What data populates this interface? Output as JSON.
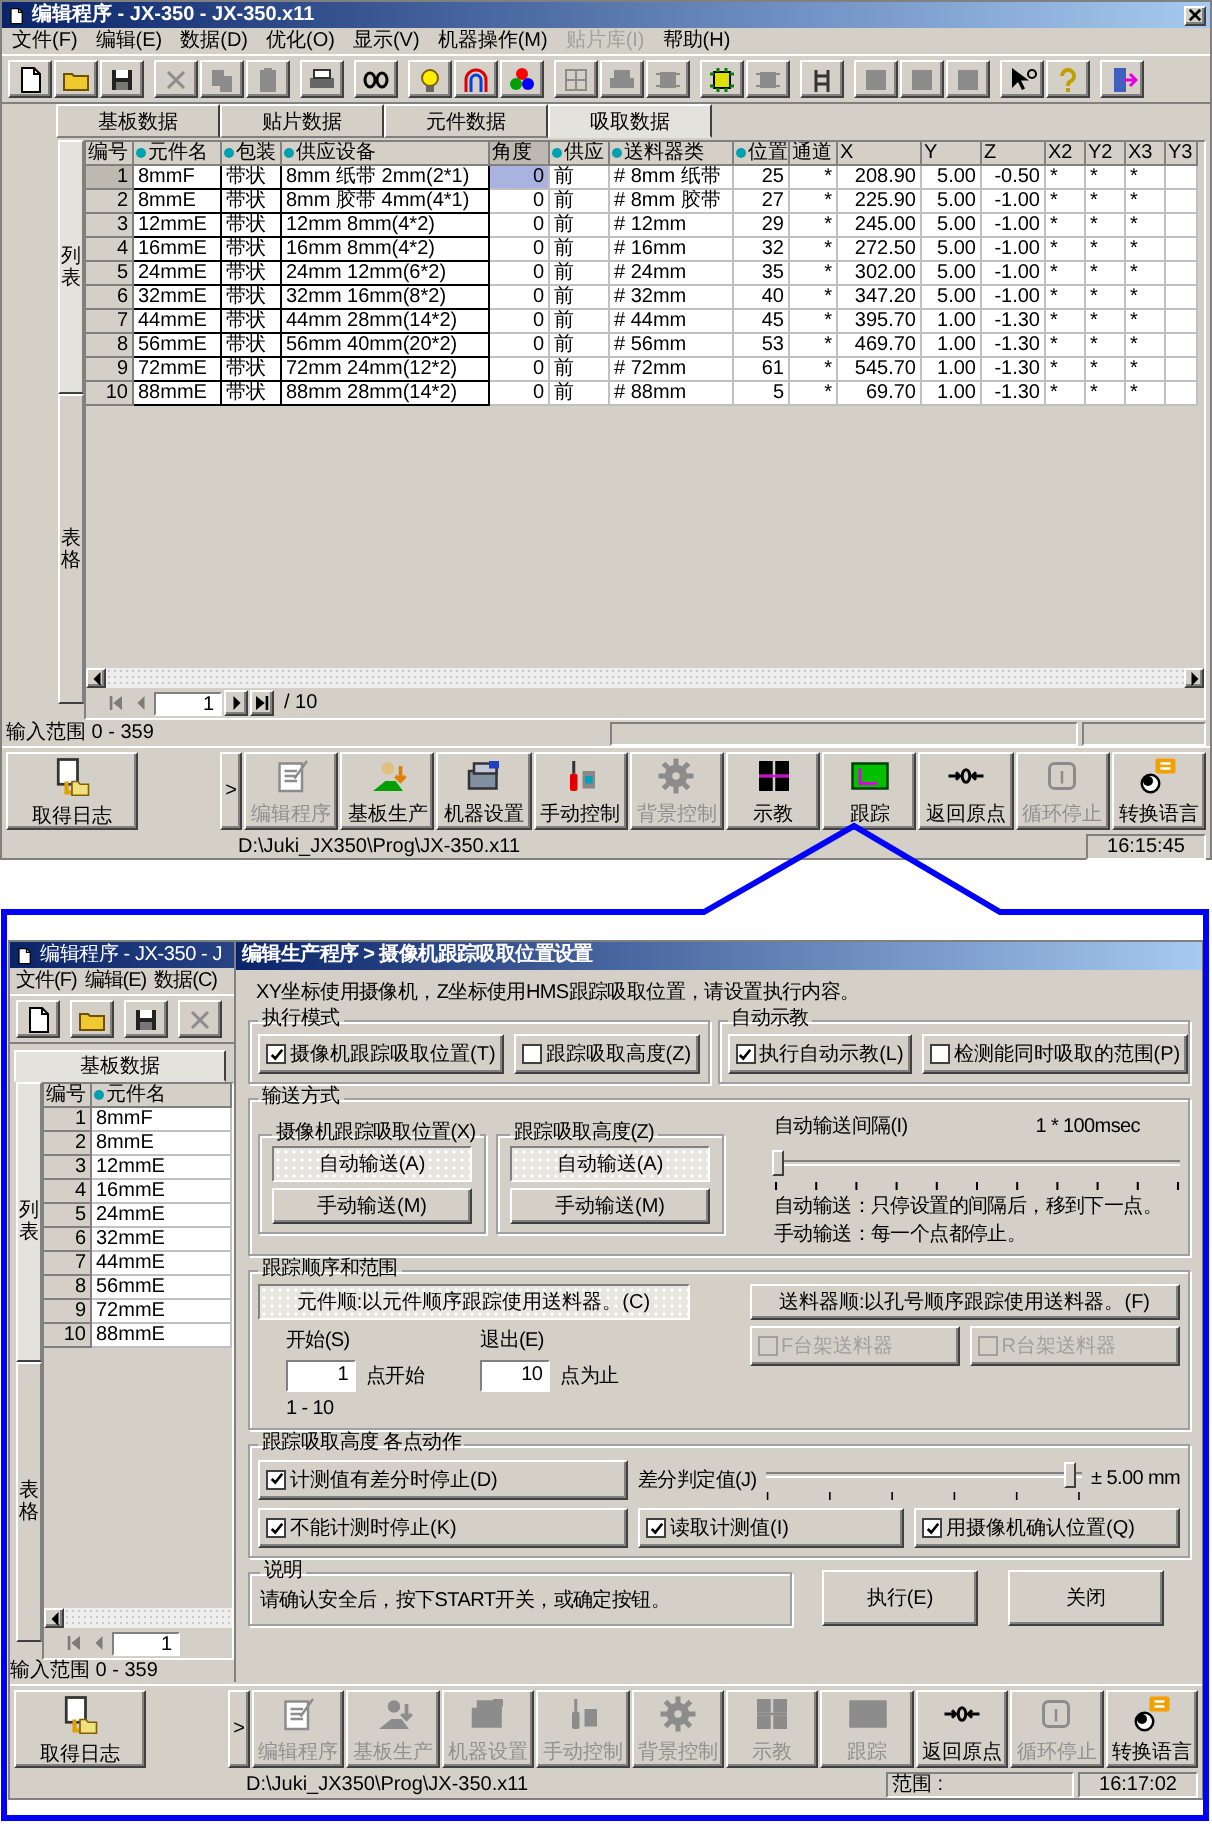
{
  "main_window": {
    "title": "编辑程序 - JX-350 - JX-350.x11",
    "menu": [
      {
        "label": "文件(F)",
        "disabled": false
      },
      {
        "label": "编辑(E)",
        "disabled": false
      },
      {
        "label": "数据(D)",
        "disabled": false
      },
      {
        "label": "优化(O)",
        "disabled": false
      },
      {
        "label": "显示(V)",
        "disabled": false
      },
      {
        "label": "机器操作(M)",
        "disabled": false
      },
      {
        "label": "贴片库(I)",
        "disabled": true
      },
      {
        "label": "帮助(H)",
        "disabled": false
      }
    ],
    "toolbar_groups": [
      [
        {
          "disabled": false
        },
        {
          "disabled": false
        },
        {
          "disabled": false
        }
      ],
      [
        {
          "disabled": true
        },
        {
          "disabled": true
        },
        {
          "disabled": true
        }
      ],
      [
        {
          "disabled": false
        }
      ],
      [
        {
          "disabled": false
        }
      ],
      [
        {
          "disabled": false
        },
        {
          "disabled": false
        },
        {
          "disabled": false
        }
      ],
      [
        {
          "disabled": true
        },
        {
          "disabled": true
        },
        {
          "disabled": true
        }
      ],
      [
        {
          "disabled": false
        },
        {
          "disabled": true
        }
      ],
      [
        {
          "disabled": false
        }
      ],
      [
        {
          "disabled": true
        },
        {
          "disabled": true
        },
        {
          "disabled": true
        }
      ],
      [
        {
          "disabled": false
        },
        {
          "disabled": false
        }
      ],
      [
        {
          "disabled": false
        }
      ]
    ],
    "tabs": [
      {
        "label": "基板数据",
        "selected": false
      },
      {
        "label": "贴片数据",
        "selected": false
      },
      {
        "label": "元件数据",
        "selected": false
      },
      {
        "label": "吸取数据",
        "selected": true
      }
    ],
    "side_tabs": [
      {
        "label": "列表",
        "selected": true
      },
      {
        "label": "表格",
        "selected": false
      }
    ],
    "table": {
      "columns": [
        {
          "label": "编号",
          "marked": false,
          "selected": false
        },
        {
          "label": "元件名",
          "marked": true,
          "selected": false
        },
        {
          "label": "包装",
          "marked": true,
          "selected": false
        },
        {
          "label": "供应设备",
          "marked": true,
          "selected": false
        },
        {
          "label": "角度",
          "marked": false,
          "selected": true
        },
        {
          "label": "供应",
          "marked": true,
          "selected": false
        },
        {
          "label": "送料器类",
          "marked": true,
          "selected": false
        },
        {
          "label": "位置",
          "marked": true,
          "selected": false
        },
        {
          "label": "通道",
          "marked": false,
          "selected": false
        },
        {
          "label": "X",
          "marked": false,
          "selected": false
        },
        {
          "label": "Y",
          "marked": false,
          "selected": false
        },
        {
          "label": "Z",
          "marked": false,
          "selected": false
        },
        {
          "label": "X2",
          "marked": false,
          "selected": false
        },
        {
          "label": "Y2",
          "marked": false,
          "selected": false
        },
        {
          "label": "X3",
          "marked": false,
          "selected": false
        },
        {
          "label": "Y3",
          "marked": false,
          "selected": false
        }
      ],
      "rows": [
        {
          "selected": true,
          "cells": [
            "1",
            "8mmF",
            "带状",
            "8mm 纸带 2mm(2*1)",
            "0",
            "前",
            "# 8mm 纸带",
            "25",
            "*",
            "208.90",
            "5.00",
            "-0.50",
            "*",
            "*",
            "*"
          ]
        },
        {
          "selected": false,
          "cells": [
            "2",
            "8mmE",
            "带状",
            "8mm 胶带 4mm(4*1)",
            "0",
            "前",
            "# 8mm 胶带",
            "27",
            "*",
            "225.90",
            "5.00",
            "-1.00",
            "*",
            "*",
            "*"
          ]
        },
        {
          "selected": false,
          "cells": [
            "3",
            "12mmE",
            "带状",
            "12mm 8mm(4*2)",
            "0",
            "前",
            "# 12mm",
            "29",
            "*",
            "245.00",
            "5.00",
            "-1.00",
            "*",
            "*",
            "*"
          ]
        },
        {
          "selected": false,
          "cells": [
            "4",
            "16mmE",
            "带状",
            "16mm 8mm(4*2)",
            "0",
            "前",
            "# 16mm",
            "32",
            "*",
            "272.50",
            "5.00",
            "-1.00",
            "*",
            "*",
            "*"
          ]
        },
        {
          "selected": false,
          "cells": [
            "5",
            "24mmE",
            "带状",
            "24mm 12mm(6*2)",
            "0",
            "前",
            "# 24mm",
            "35",
            "*",
            "302.00",
            "5.00",
            "-1.00",
            "*",
            "*",
            "*"
          ]
        },
        {
          "selected": false,
          "cells": [
            "6",
            "32mmE",
            "带状",
            "32mm 16mm(8*2)",
            "0",
            "前",
            "# 32mm",
            "40",
            "*",
            "347.20",
            "5.00",
            "-1.00",
            "*",
            "*",
            "*"
          ]
        },
        {
          "selected": false,
          "cells": [
            "7",
            "44mmE",
            "带状",
            "44mm 28mm(14*2)",
            "0",
            "前",
            "# 44mm",
            "45",
            "*",
            "395.70",
            "1.00",
            "-1.30",
            "*",
            "*",
            "*"
          ]
        },
        {
          "selected": false,
          "cells": [
            "8",
            "56mmE",
            "带状",
            "56mm 40mm(20*2)",
            "0",
            "前",
            "# 56mm",
            "53",
            "*",
            "469.70",
            "1.00",
            "-1.30",
            "*",
            "*",
            "*"
          ]
        },
        {
          "selected": false,
          "cells": [
            "9",
            "72mmE",
            "带状",
            "72mm 24mm(12*2)",
            "0",
            "前",
            "# 72mm",
            "61",
            "*",
            "545.70",
            "1.00",
            "-1.30",
            "*",
            "*",
            "*"
          ]
        },
        {
          "selected": false,
          "cells": [
            "10",
            "88mmE",
            "带状",
            "88mm 28mm(14*2)",
            "0",
            "前",
            "# 88mm",
            "5",
            "*",
            "69.70",
            "1.00",
            "-1.30",
            "*",
            "*",
            "*"
          ]
        }
      ]
    },
    "pager": {
      "page": "1",
      "total": "/ 10"
    },
    "input_range": "输入范围 0 - 359",
    "log_button": "取得日志",
    "more_button": ">",
    "buttons": [
      {
        "label": "编辑程序",
        "disabled": true
      },
      {
        "label": "基板生产",
        "disabled": false
      },
      {
        "label": "机器设置",
        "disabled": false
      },
      {
        "label": "手动控制",
        "disabled": false
      },
      {
        "label": "背景控制",
        "disabled": true
      },
      {
        "label": "示教",
        "disabled": false
      },
      {
        "label": "跟踪",
        "disabled": false
      },
      {
        "label": "返回原点",
        "disabled": false
      },
      {
        "label": "循环停止",
        "disabled": true
      },
      {
        "label": "转换语言",
        "disabled": false
      }
    ],
    "status": {
      "path": "D:\\Juki_JX350\\Prog\\JX-350.x11",
      "time": "16:15:45"
    }
  },
  "detail": {
    "background_window": {
      "title": "编辑程序 - JX-350 - J",
      "menu": [
        {
          "label": "文件(F)"
        },
        {
          "label": "编辑(E)"
        },
        {
          "label": "数据(C)"
        }
      ],
      "toolbar": [
        {
          "disabled": false
        },
        {
          "disabled": false
        },
        {
          "disabled": false
        },
        {
          "disabled": true
        }
      ],
      "tab": "基板数据",
      "side_tabs": [
        {
          "label": "列表",
          "selected": true
        },
        {
          "label": "表格",
          "selected": false
        }
      ],
      "columns": [
        {
          "label": "编号",
          "marked": false
        },
        {
          "label": "元件名",
          "marked": true
        }
      ],
      "rows": [
        {
          "number": "1",
          "name": "8mmF"
        },
        {
          "number": "2",
          "name": "8mmE"
        },
        {
          "number": "3",
          "name": "12mmE"
        },
        {
          "number": "4",
          "name": "16mmE"
        },
        {
          "number": "5",
          "name": "24mmE"
        },
        {
          "number": "6",
          "name": "32mmE"
        },
        {
          "number": "7",
          "name": "44mmE"
        },
        {
          "number": "8",
          "name": "56mmE"
        },
        {
          "number": "9",
          "name": "72mmE"
        },
        {
          "number": "10",
          "name": "88mmE"
        }
      ],
      "pager": {
        "page": "1"
      },
      "input_range": "输入范围 0 - 359",
      "log_button": "取得日志",
      "more_button": ">",
      "buttons": [
        {
          "label": "编辑程序",
          "disabled": true
        },
        {
          "label": "基板生产",
          "disabled": true
        },
        {
          "label": "机器设置",
          "disabled": true
        },
        {
          "label": "手动控制",
          "disabled": true
        },
        {
          "label": "背景控制",
          "disabled": true
        },
        {
          "label": "示教",
          "disabled": true
        },
        {
          "label": "跟踪",
          "disabled": true
        },
        {
          "label": "返回原点",
          "disabled": false
        },
        {
          "label": "循环停止",
          "disabled": true
        },
        {
          "label": "转换语言",
          "disabled": false
        }
      ],
      "status": {
        "path": "D:\\Juki_JX350\\Prog\\JX-350.x11",
        "range": "范围 :",
        "time": "16:17:02"
      }
    },
    "dialog": {
      "title": "编辑生产程序 > 摄像机跟踪吸取位置设置",
      "intro": "XY坐标使用摄像机，Z坐标使用HMS跟踪吸取位置，请设置执行内容。",
      "mode_group": {
        "title": "执行模式",
        "options": [
          {
            "label": "摄像机跟踪吸取位置(T)",
            "checked": true
          },
          {
            "label": "跟踪吸取高度(Z)",
            "checked": false
          }
        ]
      },
      "teach_group": {
        "title": "自动示教",
        "options": [
          {
            "label": "执行自动示教(L)",
            "checked": true
          },
          {
            "label": "检测能同时吸取的范围(P)",
            "checked": false
          }
        ]
      },
      "feed_group": {
        "title": "输送方式",
        "subgroups": [
          {
            "title": "摄像机跟踪吸取位置(X)",
            "options": [
              {
                "label": "自动输送(A)",
                "selected": true
              },
              {
                "label": "手动输送(M)",
                "selected": false
              }
            ]
          },
          {
            "title": "跟踪吸取高度(Z)",
            "options": [
              {
                "label": "自动输送(A)",
                "selected": true
              },
              {
                "label": "手动输送(M)",
                "selected": false
              }
            ]
          }
        ],
        "interval_label": "自动输送间隔(I)",
        "interval_value": "1 * 100msec",
        "interval_slider": {
          "level": 0
        },
        "notes": [
          "自动输送：只停设置的间隔后，移到下一点。",
          "手动输送：每一个点都停止。"
        ]
      },
      "order_group": {
        "title": "跟踪顺序和范围",
        "modes": [
          {
            "label": "元件顺:以元件顺序跟踪使用送料器。(C)",
            "selected": true
          },
          {
            "label": "送料器顺:以孔号顺序跟踪使用送料器。(F)",
            "selected": false
          }
        ],
        "tables": [
          {
            "label": "F台架送料器",
            "checked": false,
            "disabled": true
          },
          {
            "label": "R台架送料器",
            "checked": false,
            "disabled": true
          }
        ],
        "start": {
          "label": "开始(S)",
          "value": "1",
          "suffix": "点开始"
        },
        "end": {
          "label": "退出(E)",
          "value": "10",
          "suffix": "点为止"
        },
        "range": "1 - 10"
      },
      "height_group": {
        "title": "跟踪吸取高度  各点动作",
        "options": [
          {
            "label": "计测值有差分时停止(D)",
            "checked": true
          },
          {
            "label": "不能计测时停止(K)",
            "checked": true
          },
          {
            "label": "读取计测值(I)",
            "checked": true
          },
          {
            "label": "用摄像机确认位置(Q)",
            "checked": true
          }
        ],
        "threshold_label": "差分判定值(J)",
        "threshold_slider": {
          "level": 0.95
        },
        "threshold_value": "± 5.00 mm"
      },
      "note_group": {
        "title": "说明",
        "text": "请确认安全后，按下START开关，或确定按钮。"
      },
      "buttons": [
        "执行(E)",
        "关闭"
      ]
    }
  }
}
